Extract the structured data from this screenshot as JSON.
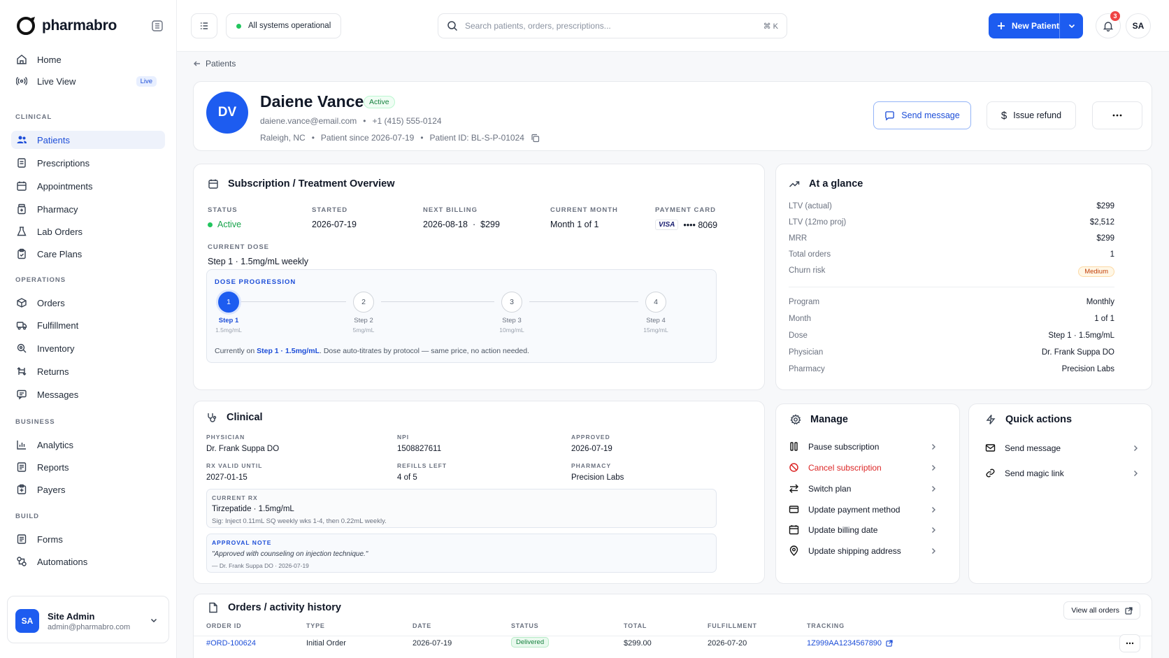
{
  "brand": {
    "name": "pharmabro"
  },
  "sidebar": {
    "top_items": [
      {
        "label": "Home"
      },
      {
        "label": "Live View",
        "badge": "Live"
      }
    ],
    "sections": [
      {
        "title": "CLINICAL",
        "items": [
          {
            "label": "Patients",
            "active": true,
            "icon": "users-icon"
          },
          {
            "label": "Prescriptions",
            "icon": "document-icon"
          },
          {
            "label": "Appointments",
            "icon": "calendar-icon"
          },
          {
            "label": "Pharmacy",
            "icon": "pill-bottle-icon"
          },
          {
            "label": "Lab Orders",
            "icon": "flask-icon"
          },
          {
            "label": "Care Plans",
            "icon": "clipboard-icon"
          }
        ]
      },
      {
        "title": "OPERATIONS",
        "items": [
          {
            "label": "Orders",
            "icon": "box-icon"
          },
          {
            "label": "Fulfillment",
            "icon": "truck-icon"
          },
          {
            "label": "Inventory",
            "icon": "search-icon"
          },
          {
            "label": "Returns",
            "icon": "return-icon"
          },
          {
            "label": "Messages",
            "icon": "chat-icon"
          }
        ]
      },
      {
        "title": "BUSINESS",
        "items": [
          {
            "label": "Analytics",
            "icon": "chart-icon"
          },
          {
            "label": "Reports",
            "icon": "report-icon"
          },
          {
            "label": "Payers",
            "icon": "shield-icon"
          }
        ]
      },
      {
        "title": "BUILD",
        "items": [
          {
            "label": "Forms",
            "icon": "form-icon"
          },
          {
            "label": "Automations",
            "icon": "automation-icon"
          }
        ]
      }
    ],
    "user": {
      "initials": "SA",
      "name": "Site Admin",
      "email": "admin@pharmabro.com"
    }
  },
  "topbar": {
    "status": "All systems operational",
    "search_placeholder": "Search patients, orders, prescriptions...",
    "search_shortcut": "⌘ K",
    "new_patient_label": "New Patient",
    "notification_count": "3",
    "avatar_initials": "SA"
  },
  "breadcrumb": {
    "label": "Patients"
  },
  "patient": {
    "initials": "DV",
    "name": "Daiene Vance",
    "status": "Active",
    "email": "daiene.vance@email.com",
    "phone": "+1 (415) 555-0124",
    "location": "Raleigh, NC",
    "since": "Patient since 2026-07-19",
    "patient_id": "Patient ID: BL-S-P-01024",
    "send_message": "Send message",
    "issue_refund": "Issue refund"
  },
  "subscription": {
    "title": "Subscription / Treatment Overview",
    "status_label": "STATUS",
    "status_value": "Active",
    "started_label": "STARTED",
    "started_value": "2026-07-19",
    "next_billing_label": "NEXT BILLING",
    "next_billing_date": "2026-08-18",
    "next_billing_amount": "$299",
    "current_month_label": "CURRENT MONTH",
    "current_month_value": "Month 1 of 1",
    "payment_card_label": "PAYMENT CARD",
    "card_brand": "VISA",
    "card_last4": "•••• 8069",
    "current_dose_label": "CURRENT DOSE",
    "current_dose_value": "Step 1 · 1.5mg/mL weekly",
    "dose_progression_label": "DOSE PROGRESSION",
    "steps": [
      {
        "num": "1",
        "label": "Step 1",
        "dose": "1.5mg/mL",
        "active": true
      },
      {
        "num": "2",
        "label": "Step 2",
        "dose": "5mg/mL"
      },
      {
        "num": "3",
        "label": "Step 3",
        "dose": "10mg/mL"
      },
      {
        "num": "4",
        "label": "Step 4",
        "dose": "15mg/mL"
      }
    ],
    "note_prefix": "Currently on",
    "note_highlight": "Step 1 · 1.5mg/mL",
    "note_suffix": ". Dose auto-titrates by protocol — same price, no action needed."
  },
  "glance": {
    "title": "At a glance",
    "rows_top": [
      {
        "k": "LTV (actual)",
        "v": "$299"
      },
      {
        "k": "LTV (12mo proj)",
        "v": "$2,512"
      },
      {
        "k": "MRR",
        "v": "$299"
      },
      {
        "k": "Total orders",
        "v": "1"
      },
      {
        "k": "Churn risk",
        "v": "Medium"
      }
    ],
    "rows_bottom": [
      {
        "k": "Program",
        "v": "Monthly"
      },
      {
        "k": "Month",
        "v": "1 of 1"
      },
      {
        "k": "Dose",
        "v": "Step 1 · 1.5mg/mL"
      },
      {
        "k": "Physician",
        "v": "Dr. Frank Suppa DO"
      },
      {
        "k": "Pharmacy",
        "v": "Precision Labs"
      }
    ]
  },
  "clinical": {
    "title": "Clinical",
    "physician_label": "PHYSICIAN",
    "physician": "Dr. Frank Suppa DO",
    "npi_label": "NPI",
    "npi": "1508827611",
    "approved_label": "APPROVED",
    "approved": "2026-07-19",
    "rx_valid_label": "RX VALID UNTIL",
    "rx_valid": "2027-01-15",
    "refills_label": "REFILLS LEFT",
    "refills": "4 of 5",
    "pharmacy_label": "PHARMACY",
    "pharmacy": "Precision Labs",
    "current_rx_label": "CURRENT RX",
    "current_rx": "Tirzepatide · 1.5mg/mL",
    "sig": "Sig: Inject 0.11mL SQ weekly wks 1-4, then 0.22mL weekly.",
    "approval_note_label": "APPROVAL NOTE",
    "approval_note": "\"Approved with counseling on injection technique.\"",
    "approval_by": "— Dr. Frank Suppa DO · 2026-07-19"
  },
  "manage": {
    "title": "Manage",
    "items": [
      {
        "label": "Pause subscription"
      },
      {
        "label": "Cancel subscription",
        "danger": true
      },
      {
        "label": "Switch plan"
      },
      {
        "label": "Update payment method"
      },
      {
        "label": "Update billing date"
      },
      {
        "label": "Update shipping address"
      }
    ]
  },
  "quick_actions": {
    "title": "Quick actions",
    "items": [
      {
        "label": "Send message"
      },
      {
        "label": "Send magic link"
      }
    ]
  },
  "orders": {
    "title": "Orders / activity history",
    "view_all": "View all orders",
    "headers": [
      "ORDER ID",
      "TYPE",
      "DATE",
      "STATUS",
      "TOTAL",
      "FULFILLMENT",
      "TRACKING"
    ],
    "rows": [
      {
        "id": "#ORD-100624",
        "type": "Initial Order",
        "date": "2026-07-19",
        "status": "Delivered",
        "total": "$299.00",
        "fulfillment": "2026-07-20",
        "tracking": "1Z999AA1234567890"
      }
    ]
  },
  "colors": {
    "accent": "#1d5cf0",
    "success": "#22c55e",
    "danger": "#dc2626",
    "warning": "#c2410c"
  }
}
